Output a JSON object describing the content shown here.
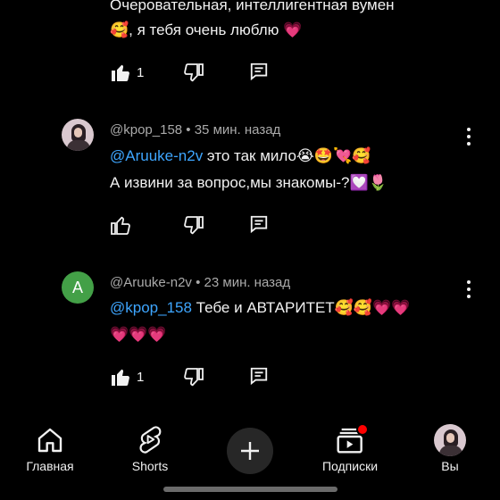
{
  "comment_prev": {
    "line1": "Очеровательная, интеллигентная вумен",
    "line2_emoji_a": "🥰",
    "line2_text": ", я тебя очень люблю ",
    "line2_emoji_b": "💗",
    "likes": "1"
  },
  "comment_1": {
    "author": "@kpop_158",
    "time": " • 35 мин. назад",
    "mention": "@Aruuke-n2v",
    "text_a": " это так мило",
    "emoji_a": "😭🤩💘🥰",
    "text_b": "А извини за вопрос,мы знакомы-?",
    "emoji_b": "💟🌷",
    "likes": ""
  },
  "comment_2": {
    "avatar_letter": "A",
    "author": "@Aruuke-n2v",
    "time": " • 23 мин. назад",
    "mention": "@kpop_158",
    "text_a": "  Тебе и АВТАРИТЕТ",
    "emoji_a": "🥰🥰💗💗",
    "emoji_b": "💗💗💗",
    "likes": "1"
  },
  "nav": {
    "home": "Главная",
    "shorts": "Shorts",
    "subs": "Подписки",
    "you": "Вы"
  },
  "colors": {
    "background": "#000000",
    "mention": "#3ea6ff",
    "avatar_green": "#43a047",
    "notification_dot": "#ff0000"
  }
}
